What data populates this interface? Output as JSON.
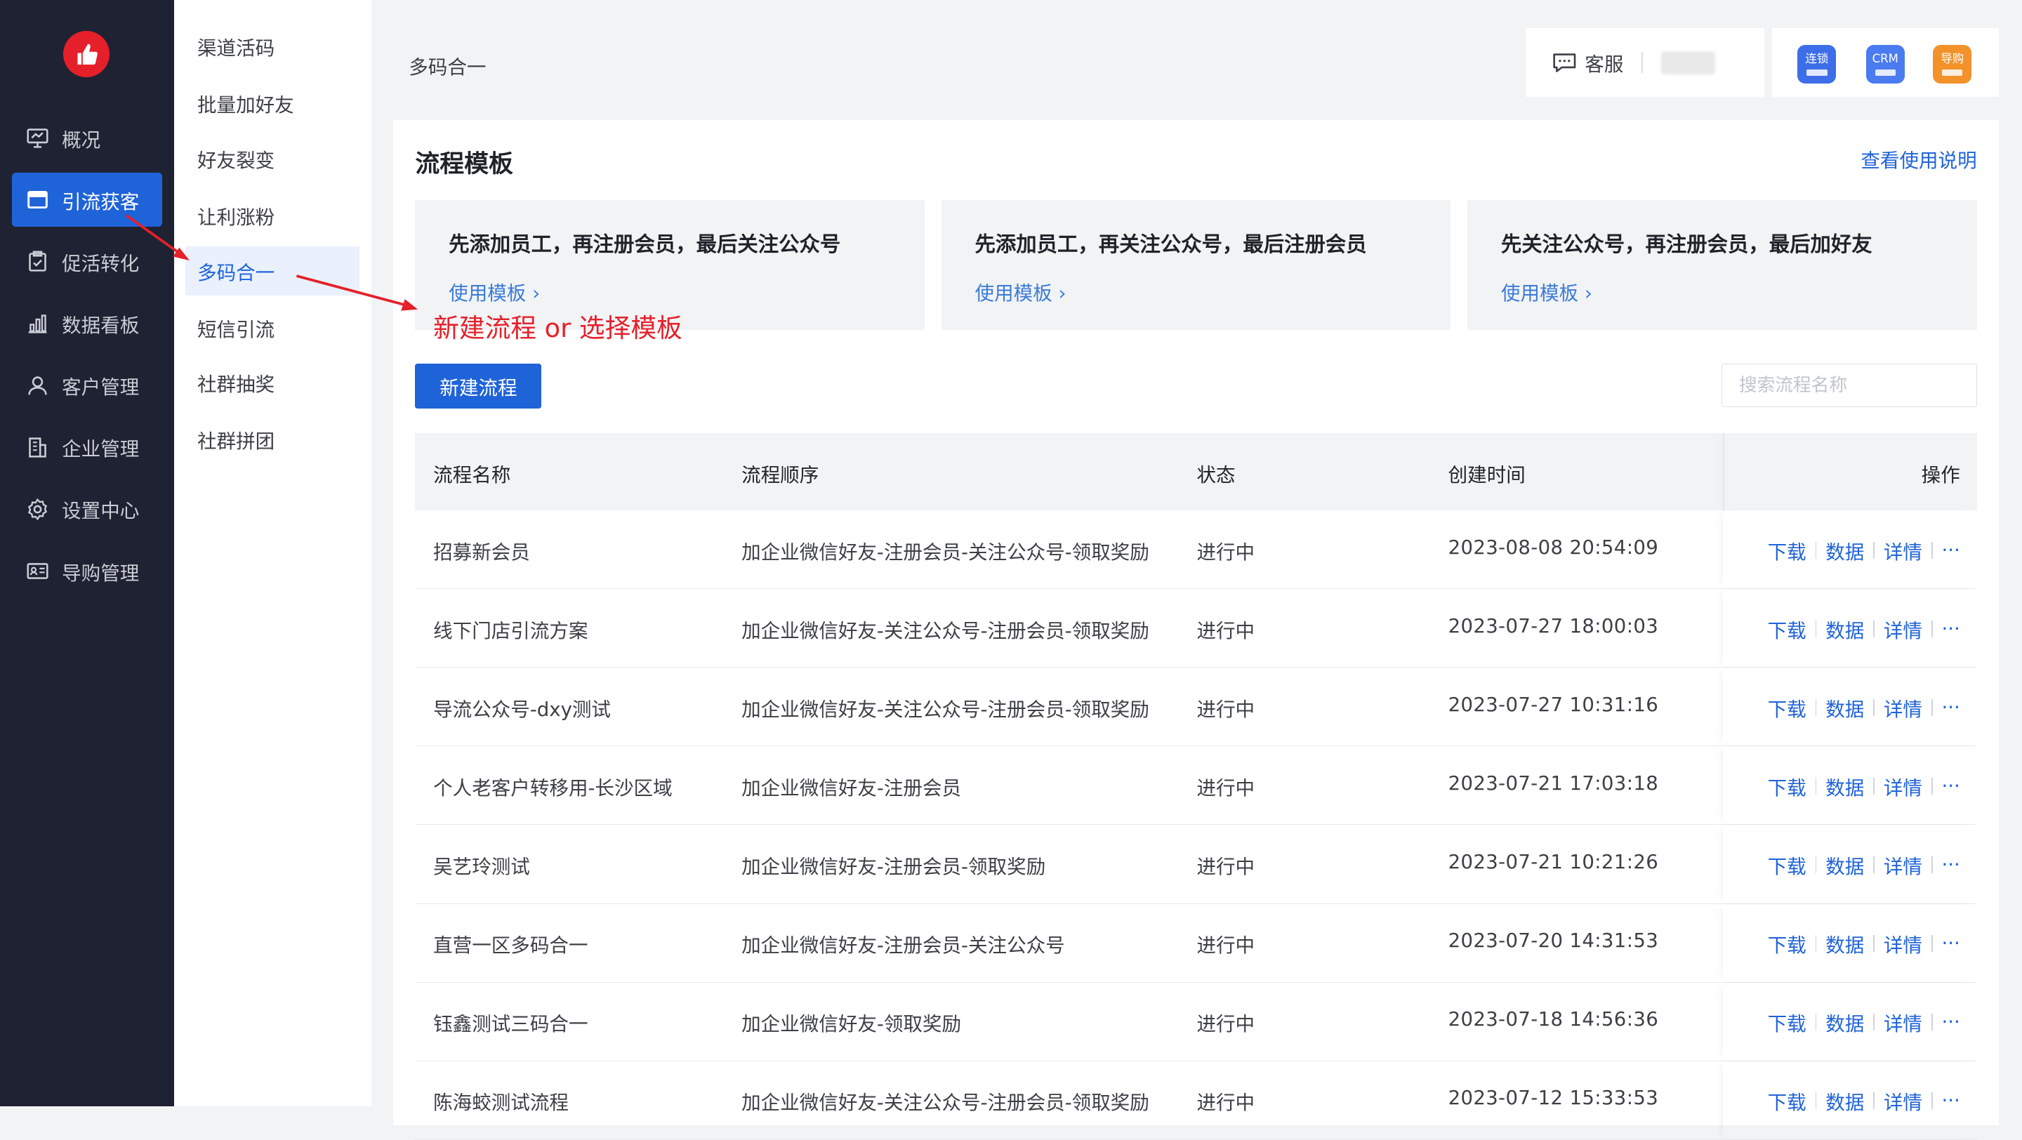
{
  "nav": {
    "items": [
      {
        "label": "概况",
        "icon": "overview-icon"
      },
      {
        "label": "引流获客",
        "icon": "store-icon",
        "active": true
      },
      {
        "label": "促活转化",
        "icon": "clipboard-icon"
      },
      {
        "label": "数据看板",
        "icon": "bar-chart-icon"
      },
      {
        "label": "客户管理",
        "icon": "user-icon"
      },
      {
        "label": "企业管理",
        "icon": "building-icon"
      },
      {
        "label": "设置中心",
        "icon": "gear-icon"
      },
      {
        "label": "导购管理",
        "icon": "id-card-icon"
      }
    ]
  },
  "submenu": {
    "items": [
      {
        "label": "渠道活码"
      },
      {
        "label": "批量加好友"
      },
      {
        "label": "好友裂变"
      },
      {
        "label": "让利涨粉"
      },
      {
        "label": "多码合一",
        "active": true
      },
      {
        "label": "短信引流"
      },
      {
        "label": "社群抽奖"
      },
      {
        "label": "社群拼团"
      }
    ]
  },
  "header": {
    "breadcrumb": "多码合一",
    "customer_service": "客服",
    "apps": [
      {
        "label": "连锁",
        "color": "#3d6ee8"
      },
      {
        "label": "CRM",
        "color": "#4b7bf0"
      },
      {
        "label": "导购",
        "color": "#f3922a"
      }
    ]
  },
  "panel": {
    "title": "流程模板",
    "help_link": "查看使用说明",
    "templates": [
      {
        "title": "先添加员工，再注册会员，最后关注公众号",
        "link": "使用模板 ›"
      },
      {
        "title": "先添加员工，再关注公众号，最后注册会员",
        "link": "使用模板 ›"
      },
      {
        "title": "先关注公众号，再注册会员，最后加好友",
        "link": "使用模板 ›"
      }
    ],
    "new_button": "新建流程",
    "search_placeholder": "搜索流程名称",
    "annotation": "新建流程 or 选择模板"
  },
  "table": {
    "columns": [
      "流程名称",
      "流程顺序",
      "状态",
      "创建时间",
      "操作"
    ],
    "ops": {
      "download": "下载",
      "data": "数据",
      "detail": "详情",
      "more": "···"
    },
    "rows": [
      {
        "name": "招募新会员",
        "order": "加企业微信好友-注册会员-关注公众号-领取奖励",
        "status": "进行中",
        "time": "2023-08-08 20:54:09"
      },
      {
        "name": "线下门店引流方案",
        "order": "加企业微信好友-关注公众号-注册会员-领取奖励",
        "status": "进行中",
        "time": "2023-07-27 18:00:03"
      },
      {
        "name": "导流公众号-dxy测试",
        "order": "加企业微信好友-关注公众号-注册会员-领取奖励",
        "status": "进行中",
        "time": "2023-07-27 10:31:16"
      },
      {
        "name": "个人老客户转移用-长沙区域",
        "order": "加企业微信好友-注册会员",
        "status": "进行中",
        "time": "2023-07-21 17:03:18"
      },
      {
        "name": "吴艺玲测试",
        "order": "加企业微信好友-注册会员-领取奖励",
        "status": "进行中",
        "time": "2023-07-21 10:21:26"
      },
      {
        "name": "直营一区多码合一",
        "order": "加企业微信好友-注册会员-关注公众号",
        "status": "进行中",
        "time": "2023-07-20 14:31:53"
      },
      {
        "name": "钰鑫测试三码合一",
        "order": "加企业微信好友-领取奖励",
        "status": "进行中",
        "time": "2023-07-18 14:56:36"
      },
      {
        "name": "陈海蛟测试流程",
        "order": "加企业微信好友-关注公众号-注册会员-领取奖励",
        "status": "进行中",
        "time": "2023-07-12 15:33:53"
      }
    ]
  },
  "colors": {
    "accent": "#1f63d9",
    "sidebar": "#1f2233",
    "annotation": "#e5202a"
  }
}
